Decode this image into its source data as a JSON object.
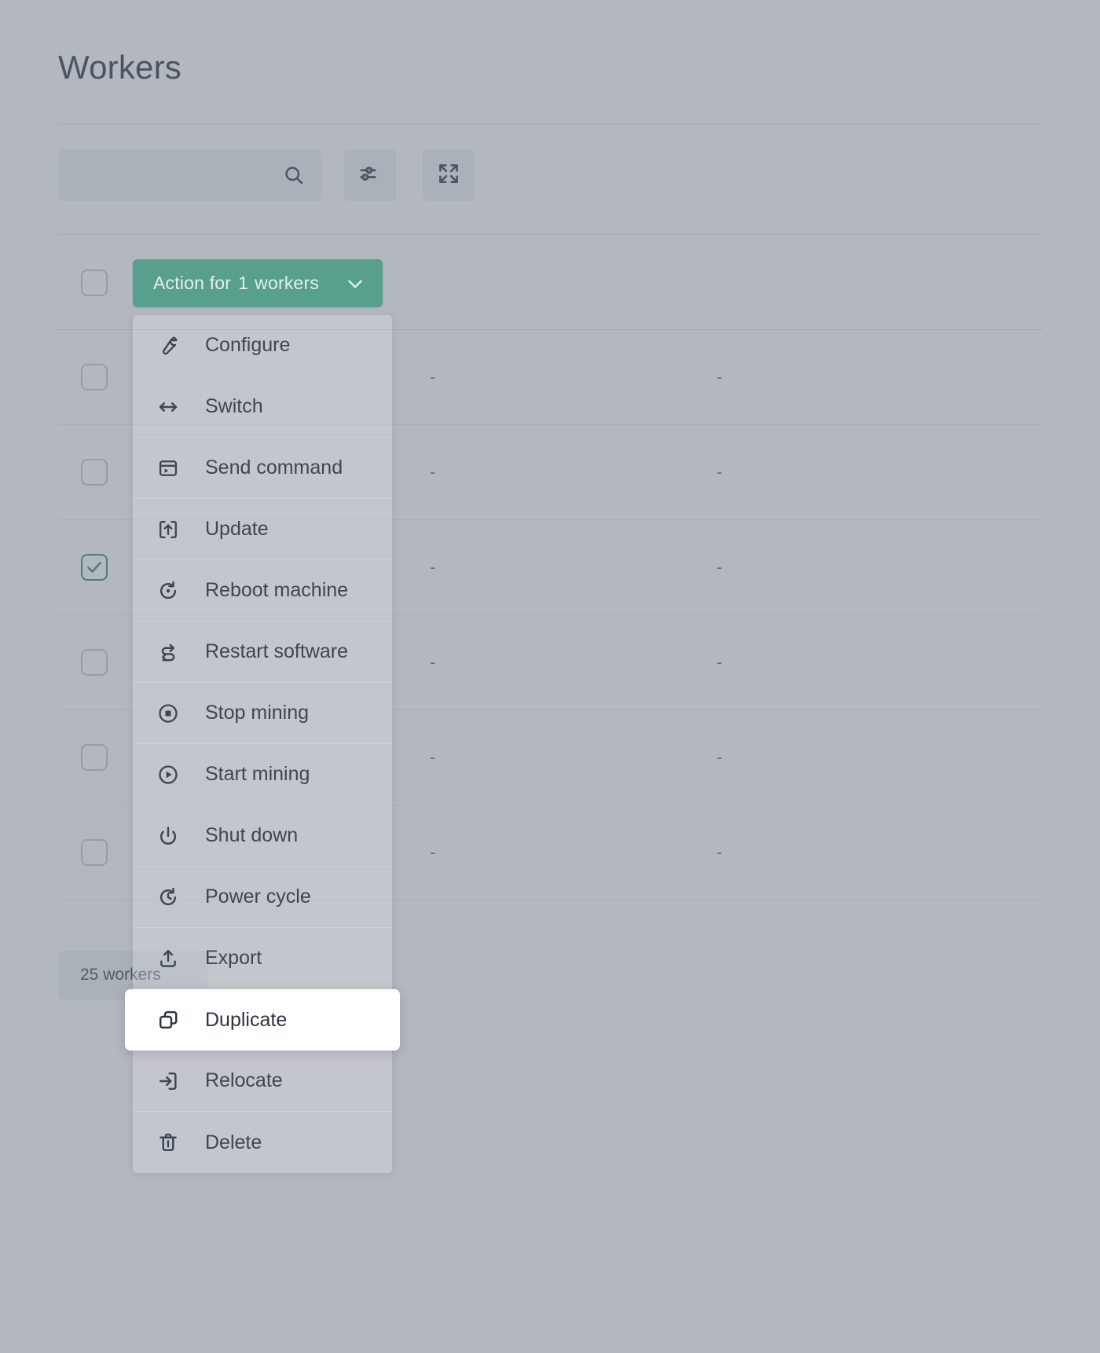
{
  "page": {
    "title": "Workers"
  },
  "toolbar": {
    "search_placeholder": "",
    "search_value": "",
    "search_icon": "search-icon",
    "filters_icon": "sliders-icon",
    "expand_icon": "maximize-icon"
  },
  "table": {
    "empty_cell": "-",
    "rows": [
      {
        "checked": false,
        "col1": "-",
        "col2": "-"
      },
      {
        "checked": false,
        "col1": "-",
        "col2": "-"
      },
      {
        "checked": true,
        "col1": "-",
        "col2": "-"
      },
      {
        "checked": false,
        "col1": "-",
        "col2": "-"
      },
      {
        "checked": false,
        "col1": "-",
        "col2": "-"
      },
      {
        "checked": false,
        "col1": "-",
        "col2": "-"
      }
    ]
  },
  "footer": {
    "count_label": "25 workers"
  },
  "action_menu": {
    "button": {
      "label_prefix": "Action for",
      "count": "1",
      "label_suffix": "workers",
      "chevron_icon": "chevron-down-icon",
      "accent_color": "#58a08d"
    },
    "items": [
      {
        "label": "Configure",
        "icon": "wrench-icon",
        "highlighted": false
      },
      {
        "label": "Switch",
        "icon": "arrows-horizontal-icon",
        "highlighted": false
      },
      {
        "label": "Send command",
        "icon": "terminal-icon",
        "highlighted": false
      },
      {
        "label": "Update",
        "icon": "upload-bracket-icon",
        "highlighted": false
      },
      {
        "label": "Reboot machine",
        "icon": "reboot-icon",
        "highlighted": false
      },
      {
        "label": "Restart software",
        "icon": "refresh-icon",
        "highlighted": false
      },
      {
        "label": "Stop mining",
        "icon": "stop-circle-icon",
        "highlighted": false
      },
      {
        "label": "Start mining",
        "icon": "play-circle-icon",
        "highlighted": false
      },
      {
        "label": "Shut down",
        "icon": "power-icon",
        "highlighted": false
      },
      {
        "label": "Power cycle",
        "icon": "power-cycle-icon",
        "highlighted": false
      },
      {
        "label": "Export",
        "icon": "export-icon",
        "highlighted": false
      },
      {
        "label": "Duplicate",
        "icon": "copy-icon",
        "highlighted": true
      },
      {
        "label": "Relocate",
        "icon": "login-arrow-icon",
        "highlighted": false
      },
      {
        "label": "Delete",
        "icon": "trash-icon",
        "highlighted": false
      }
    ]
  },
  "colors": {
    "accent_green": "#58a08d",
    "overlay": "rgba(74,83,99,0.42)",
    "text_dark": "#3e4654",
    "text_muted": "#7e8694"
  }
}
